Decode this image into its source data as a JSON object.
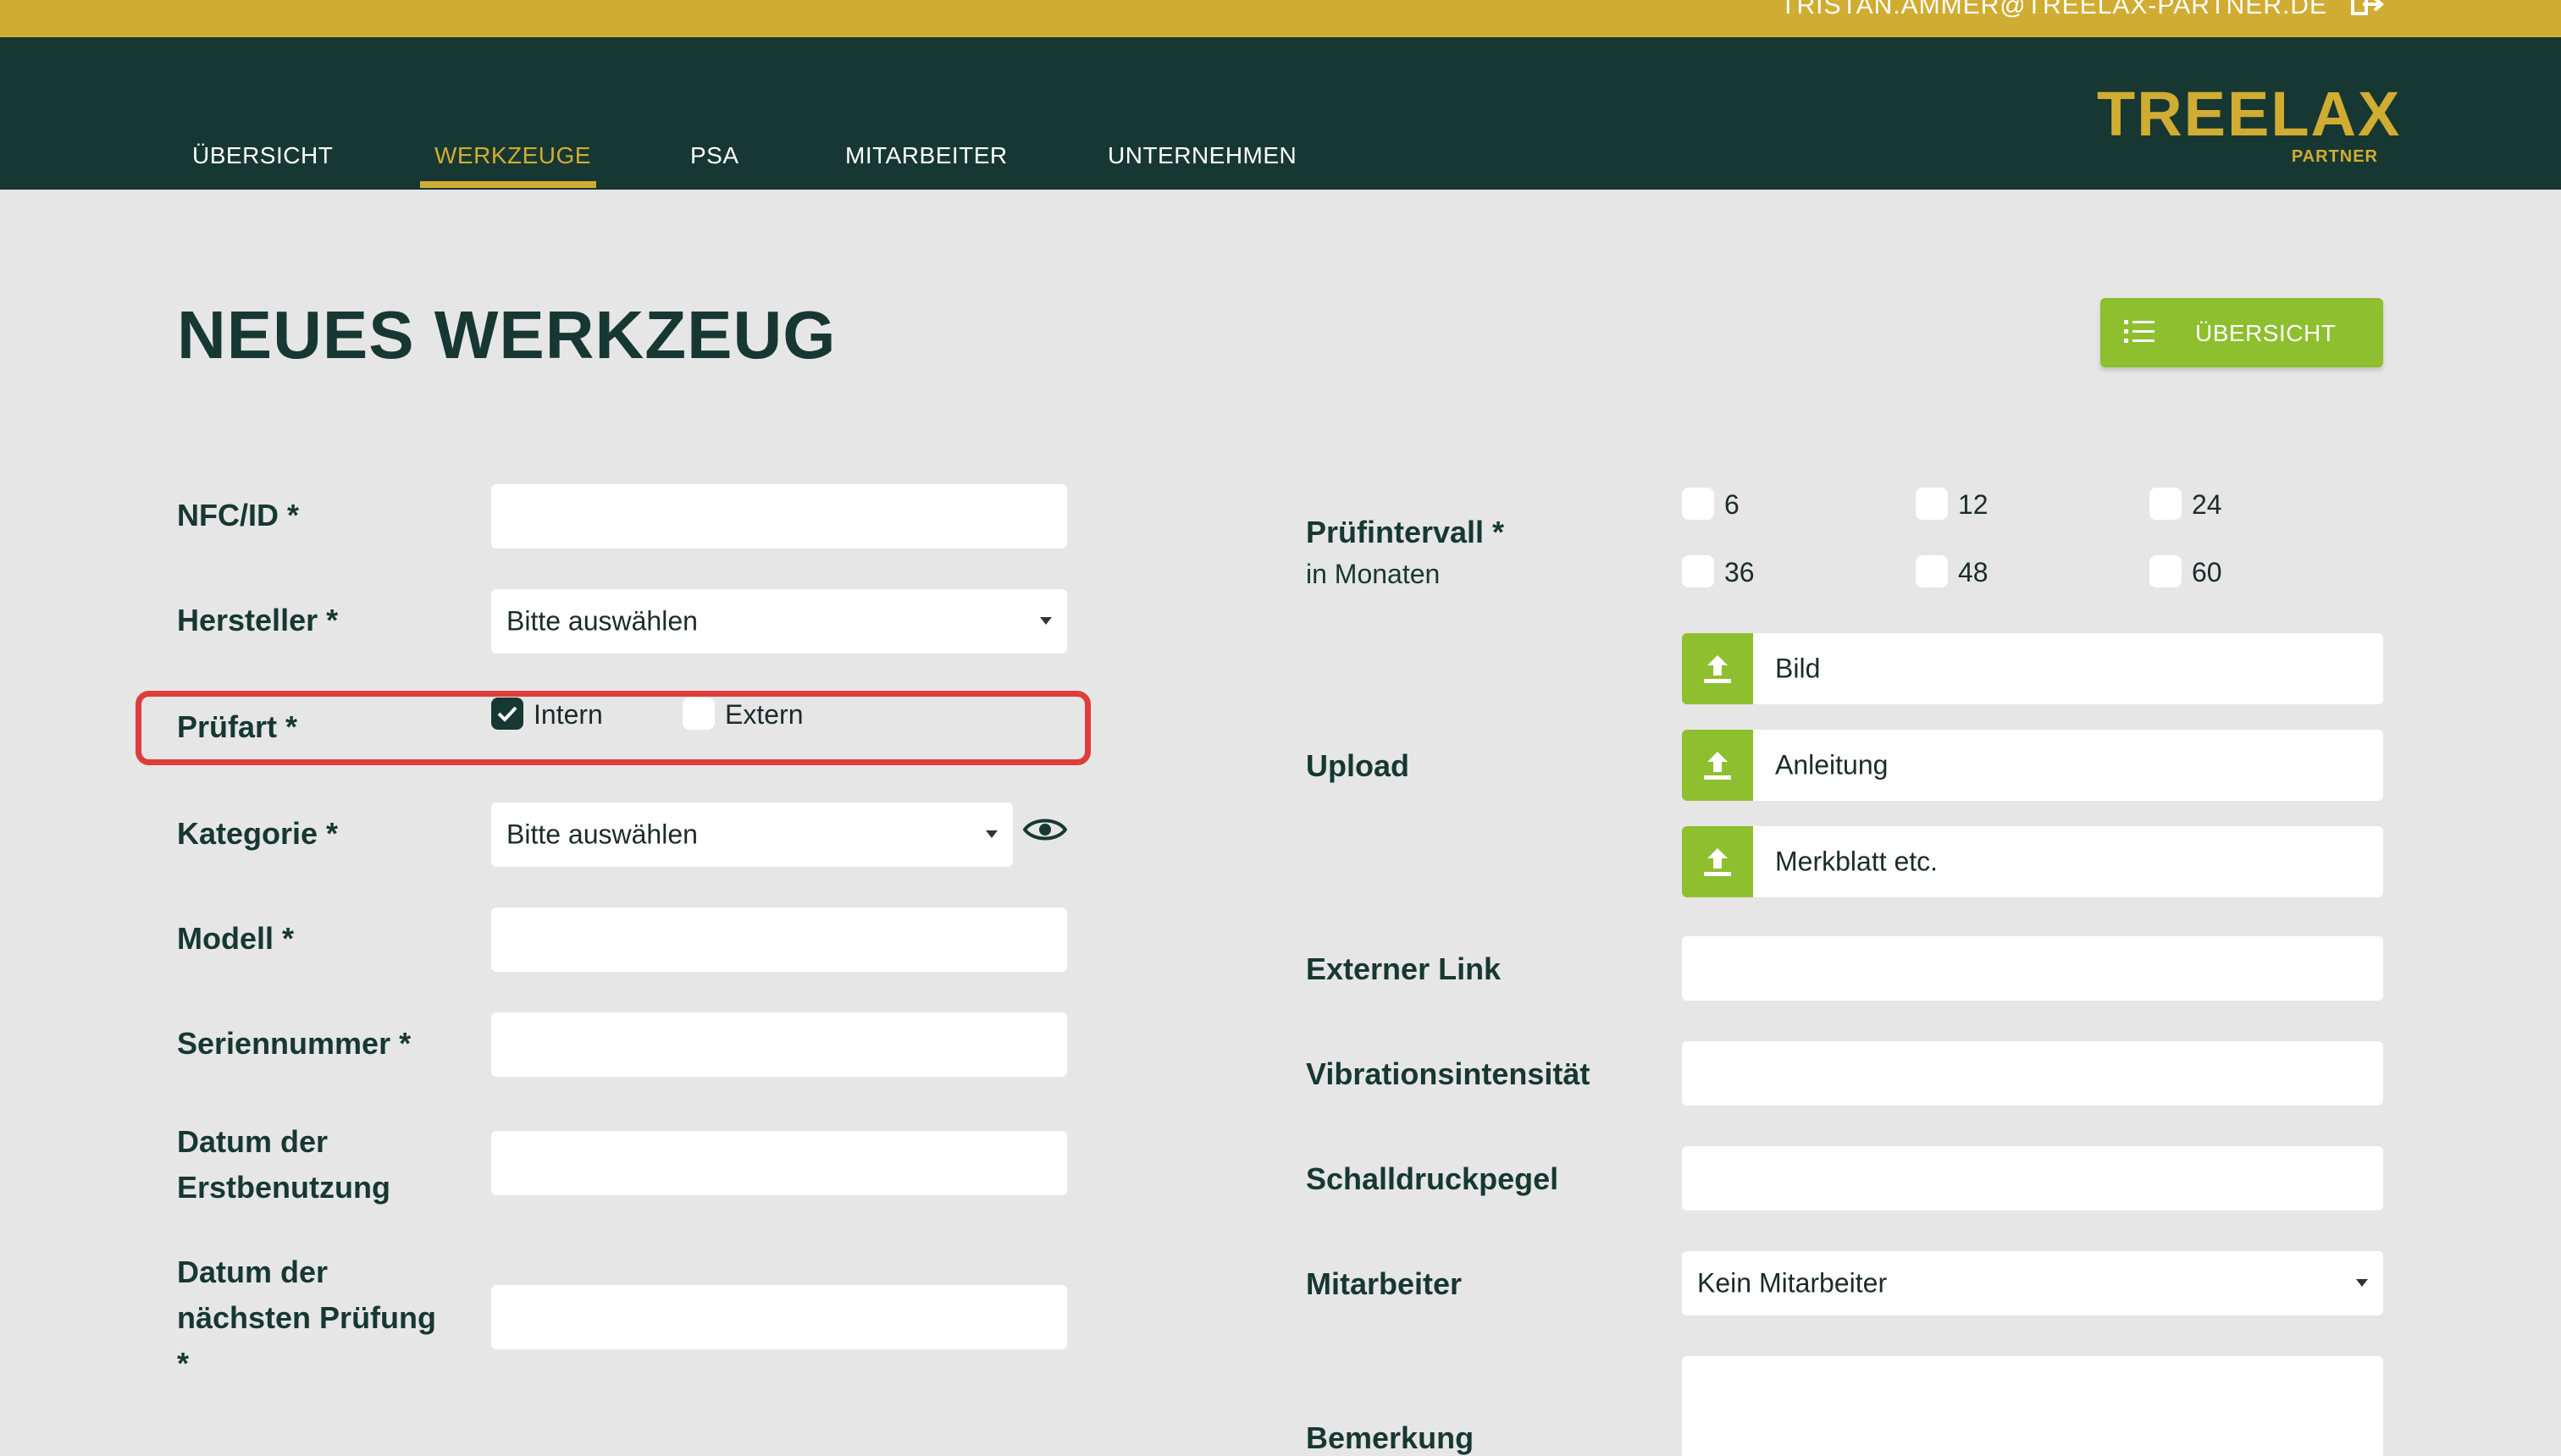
{
  "topbar": {
    "email": "TRISTAN.AMMER@TREELAX-PARTNER.DE"
  },
  "nav": {
    "items": [
      {
        "label": "ÜBERSICHT"
      },
      {
        "label": "WERKZEUGE"
      },
      {
        "label": "PSA"
      },
      {
        "label": "MITARBEITER"
      },
      {
        "label": "UNTERNEHMEN"
      }
    ],
    "active": "WERKZEUGE"
  },
  "logo": {
    "word": "TREELAX",
    "sub": "PARTNER"
  },
  "page": {
    "title": "NEUES WERKZEUG",
    "overview_button": "ÜBERSICHT"
  },
  "form_left": {
    "nfc": {
      "label": "NFC/ID *",
      "value": ""
    },
    "hersteller": {
      "label": "Hersteller *",
      "value": "Bitte auswählen"
    },
    "pruefart": {
      "label": "Prüfart *",
      "options": [
        {
          "label": "Intern",
          "checked": true
        },
        {
          "label": "Extern",
          "checked": false
        }
      ]
    },
    "kategorie": {
      "label": "Kategorie *",
      "value": "Bitte auswählen"
    },
    "modell": {
      "label": "Modell *",
      "value": ""
    },
    "seriennummer": {
      "label": "Seriennummer *",
      "value": ""
    },
    "erstbenutzung": {
      "label_line1": "Datum der",
      "label_line2": "Erstbenutzung",
      "value": ""
    },
    "naechste_pruefung": {
      "label_line1": "Datum der",
      "label_line2": "nächsten Prüfung",
      "label_line3": "*",
      "value": ""
    }
  },
  "form_right": {
    "pruefintervall": {
      "label": "Prüfintervall *",
      "sublabel": "in Monaten",
      "options": [
        {
          "label": "6",
          "checked": false
        },
        {
          "label": "12",
          "checked": false
        },
        {
          "label": "24",
          "checked": false
        },
        {
          "label": "36",
          "checked": false
        },
        {
          "label": "48",
          "checked": false
        },
        {
          "label": "60",
          "checked": false
        }
      ]
    },
    "upload": {
      "label": "Upload",
      "fields": [
        {
          "label": "Bild"
        },
        {
          "label": "Anleitung"
        },
        {
          "label": "Merkblatt etc."
        }
      ]
    },
    "externer_link": {
      "label": "Externer Link",
      "value": ""
    },
    "vibration": {
      "label": "Vibrationsintensität",
      "value": ""
    },
    "schall": {
      "label": "Schalldruckpegel",
      "value": ""
    },
    "mitarbeiter": {
      "label": "Mitarbeiter",
      "value": "Kein Mitarbeiter"
    },
    "bemerkung": {
      "label": "Bemerkung",
      "value": ""
    }
  },
  "colors": {
    "accent_yellow": "#d1ac32",
    "dark_green": "#173832",
    "button_green": "#8dbf2f",
    "highlight_red": "#e03c3c",
    "background": "#e6e6e6"
  }
}
